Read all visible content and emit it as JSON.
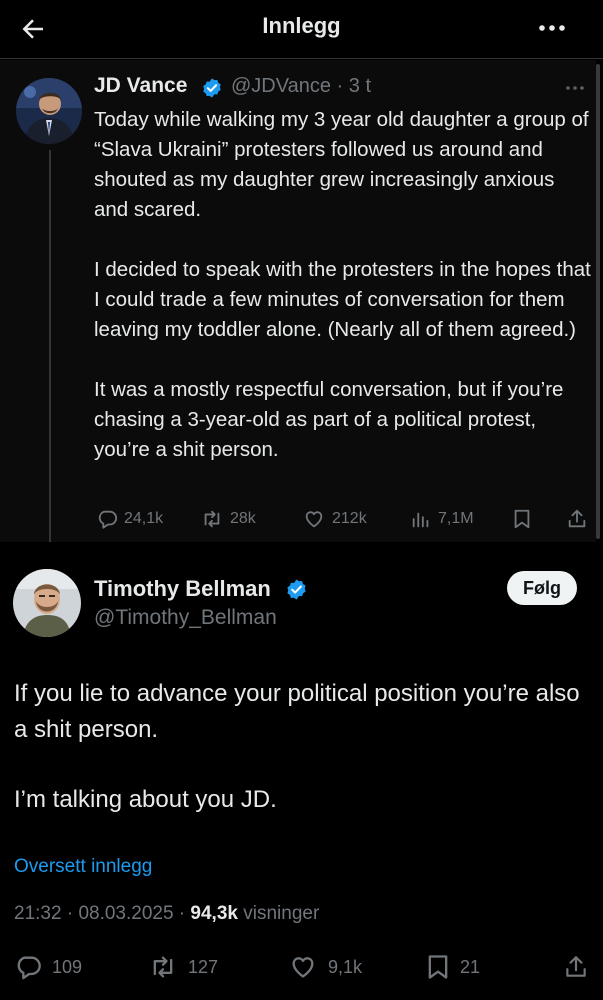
{
  "header": {
    "title": "Innlegg",
    "back_icon": "arrow-left-icon",
    "more_icon": "more-horizontal-icon"
  },
  "quoted": {
    "name": "JD Vance",
    "handle": "@JDVance",
    "time": "3 t",
    "verified": true,
    "paragraphs": [
      "Today while walking my 3 year old daughter a group of “Slava Ukraini” protesters followed us around and shouted as my daughter grew increasingly anxious and scared.",
      "I decided to speak with the protesters in the hopes that I could trade a few minutes of conversation for them leaving my toddler alone. (Nearly all of them agreed.)",
      "It was a mostly respectful conversation,  but if you’re chasing a 3-year-old as part of a political protest, you’re a shit person."
    ],
    "actions": {
      "replies": "24,1k",
      "reposts": "28k",
      "likes": "212k",
      "views": "7,1M"
    }
  },
  "main": {
    "name": "Timothy Bellman",
    "handle": "@Timothy_Bellman",
    "verified": true,
    "follow_label": "Følg",
    "paragraphs": [
      "If you lie to advance your political position you’re also a shit person.",
      "I’m talking about you JD."
    ],
    "translate_label": "Oversett innlegg",
    "time": "21:32",
    "date": "08.03.2025",
    "views": "94,3k",
    "views_label": "visninger",
    "actions": {
      "replies": "109",
      "reposts": "127",
      "likes": "9,1k",
      "bookmarks": "21"
    }
  },
  "colors": {
    "accent": "#1d9bf0",
    "text": "#e7e9ea",
    "muted": "#71767b",
    "background": "#000000"
  }
}
